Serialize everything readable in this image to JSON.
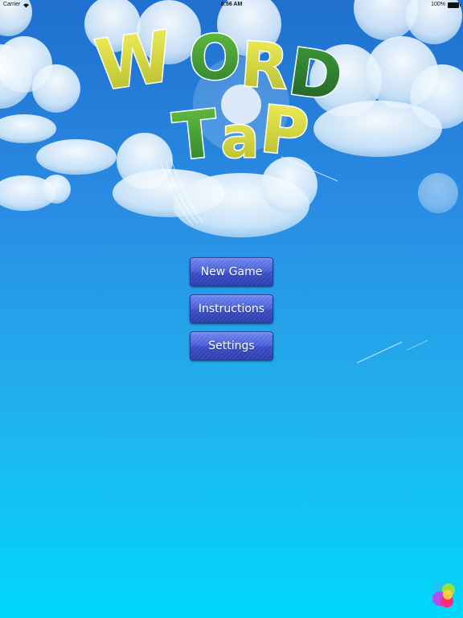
{
  "status_bar": {
    "carrier": "Carrier",
    "time": "6:56 AM",
    "battery": "100%"
  },
  "icons": {
    "wifi": "wifi-icon",
    "battery": "battery-icon",
    "game_center": "game-center-icon"
  },
  "logo": {
    "line1": "WORD",
    "line2": "Tap"
  },
  "menu": {
    "new_game": "New Game",
    "instructions": "Instructions",
    "settings": "Settings"
  },
  "colors": {
    "sky_top": "#1f6fcf",
    "sky_bottom": "#00d8fb",
    "button": "#4d63dc",
    "logo_yellow": "#d9d83a",
    "logo_green": "#3f9b3a"
  }
}
